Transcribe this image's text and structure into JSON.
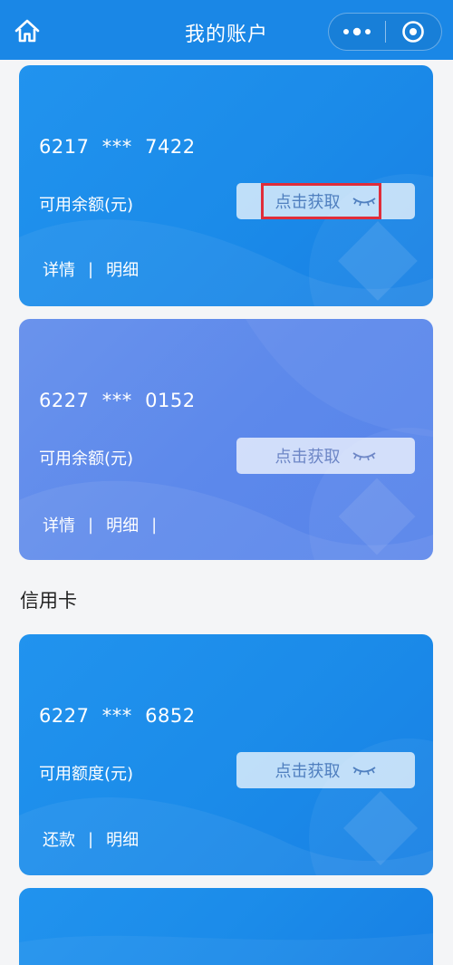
{
  "header": {
    "title": "我的账户"
  },
  "debit_cards": [
    {
      "number": "6217  ***  7422",
      "balance_label": "可用余额(元)",
      "fetch_label": "点击获取",
      "links": [
        "详情",
        "明细"
      ]
    },
    {
      "number": "6227  ***  0152",
      "balance_label": "可用余额(元)",
      "fetch_label": "点击获取",
      "links": [
        "详情",
        "明细"
      ]
    }
  ],
  "credit_section": {
    "title": "信用卡"
  },
  "credit_cards": [
    {
      "number": "6227  ***  6852",
      "balance_label": "可用额度(元)",
      "fetch_label": "点击获取",
      "links": [
        "还款",
        "明细"
      ]
    }
  ],
  "colors": {
    "header": "#1a87e6",
    "card_blue": "#1b8be9",
    "card_purple": "#5d89eb",
    "highlight": "#e02d3a"
  }
}
